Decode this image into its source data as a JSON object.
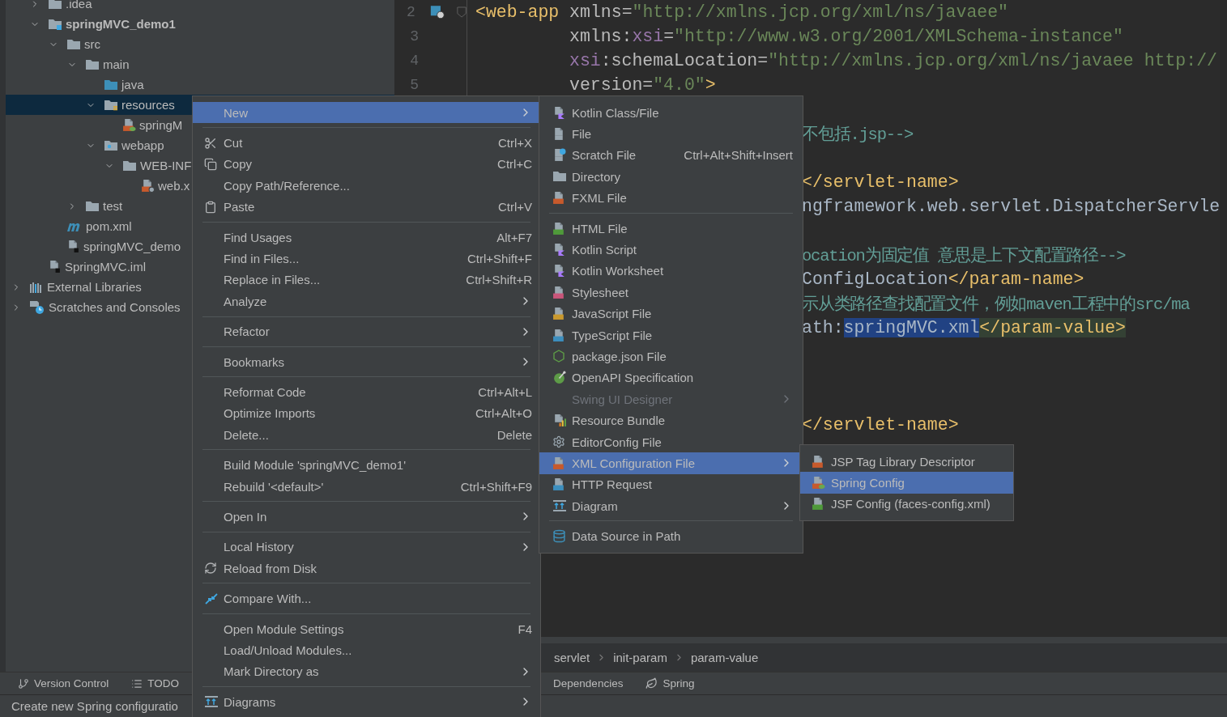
{
  "project_tree": [
    {
      "children": [
        {
          "label": ".idea",
          "kind": "folder",
          "expanded": false,
          "selected": false
        },
        {
          "label": "springMVC_demo1",
          "kind": "module",
          "expanded": true,
          "selected": false,
          "children": [
            {
              "label": "src",
              "kind": "folder",
              "expanded": true,
              "selected": false,
              "children": [
                {
                  "label": "main",
                  "kind": "folder",
                  "expanded": true,
                  "selected": false,
                  "children": [
                    {
                      "label": "java",
                      "kind": "source",
                      "selected": false
                    },
                    {
                      "label": "resources",
                      "kind": "resources",
                      "expanded": true,
                      "selected": true,
                      "children": [
                        {
                          "label": "springM",
                          "kind": "spring-xml",
                          "selected": false
                        }
                      ]
                    },
                    {
                      "label": "webapp",
                      "kind": "web",
                      "expanded": true,
                      "selected": false,
                      "children": [
                        {
                          "label": "WEB-INF",
                          "kind": "folder",
                          "expanded": true,
                          "selected": false,
                          "children": [
                            {
                              "label": "web.x",
                              "kind": "web-xml",
                              "selected": false
                            }
                          ]
                        }
                      ]
                    }
                  ]
                },
                {
                  "label": "test",
                  "kind": "folder",
                  "expanded": false,
                  "selected": false
                }
              ]
            },
            {
              "label": "pom.xml",
              "kind": "maven",
              "selected": false
            },
            {
              "label": "springMVC_demo",
              "kind": "iml",
              "selected": false
            }
          ]
        },
        {
          "label": "SpringMVC.iml",
          "kind": "iml",
          "selected": false
        }
      ]
    },
    {
      "label": "External Libraries",
      "kind": "libraries",
      "expanded": false,
      "selected": false
    },
    {
      "label": "Scratches and Consoles",
      "kind": "scratches",
      "expanded": false,
      "selected": false
    }
  ],
  "editor": {
    "lines": [
      {
        "kind": "first",
        "number": "2",
        "tokens": [
          {
            "t": "<web-app",
            "kind": "tag"
          },
          {
            "t": " xmlns=",
            "kind": "attr"
          },
          {
            "t": "\"http://xmlns.jcp.org/xml/ns/javaee\"",
            "kind": "val"
          }
        ]
      },
      {
        "kind": "cont",
        "number": "3",
        "tokens": [
          {
            "t": "xmlns:",
            "kind": "attr"
          },
          {
            "t": "xsi",
            "kind": "ns"
          },
          {
            "t": "=",
            "kind": "attr"
          },
          {
            "t": "\"http://www.w3.org/2001/XMLSchema-instance\"",
            "kind": "val"
          }
        ]
      },
      {
        "kind": "cont",
        "number": "4",
        "tokens": [
          {
            "t": "xsi",
            "kind": "ns"
          },
          {
            "t": ":schemaLocation=",
            "kind": "attr"
          },
          {
            "t": "\"http://xmlns.jcp.org/xml/ns/javaee http://",
            "kind": "val"
          }
        ]
      },
      {
        "kind": "cont",
        "number": "5",
        "tokens": [
          {
            "t": "version=",
            "kind": "attr"
          },
          {
            "t": "\"4.0\"",
            "kind": "val"
          },
          {
            "t": ">",
            "kind": "tag"
          }
        ]
      },
      {
        "kind": "blank"
      },
      {
        "kind": "tail",
        "tokens": [
          {
            "t": "不包括.jsp-->",
            "kind": "comment"
          }
        ]
      },
      {
        "kind": "blank"
      },
      {
        "kind": "tail",
        "tokens": [
          {
            "t": "</servlet-name>",
            "kind": "tag"
          }
        ]
      },
      {
        "kind": "tail",
        "tokens": [
          {
            "t": "ngframework.web.servlet.DispatcherServle",
            "kind": "plain"
          }
        ]
      },
      {
        "kind": "blank"
      },
      {
        "kind": "tail",
        "tokens": [
          {
            "t": "ocation为固定值 意思是上下文配置路径-->",
            "kind": "comment"
          }
        ]
      },
      {
        "kind": "tail",
        "tokens": [
          {
            "t": "ConfigLocation",
            "kind": "plain"
          },
          {
            "t": "</param-name>",
            "kind": "tag"
          }
        ]
      },
      {
        "kind": "tail",
        "tokens": [
          {
            "t": "示从类路径查找配置文件，例如maven工程中的src/ma",
            "kind": "comment"
          }
        ]
      },
      {
        "kind": "tail",
        "tokens": [
          {
            "t": "ath:",
            "kind": "plain"
          },
          {
            "t": "springMVC.xml",
            "kind": "sel"
          },
          {
            "t": "</param-value>",
            "kind": "match"
          }
        ]
      },
      {
        "kind": "blank"
      },
      {
        "kind": "blank"
      },
      {
        "kind": "blank"
      },
      {
        "kind": "tail",
        "tokens": [
          {
            "t": "</servlet-name>",
            "kind": "tag"
          }
        ]
      }
    ]
  },
  "breadcrumbs": [
    "servlet",
    "init-param",
    "param-value"
  ],
  "tool_windows_left": [
    "Version Control",
    "TODO"
  ],
  "tool_windows_right": [
    "Dependencies",
    "Spring"
  ],
  "status_bar": "Create new Spring configuratio",
  "context_menu": {
    "items": [
      {
        "kind": "item",
        "label": "New",
        "submenu": true,
        "selected": true
      },
      {
        "kind": "separator"
      },
      {
        "kind": "item",
        "label": "Cut",
        "shortcut": "Ctrl+X",
        "submenu": false,
        "selected": false
      },
      {
        "kind": "item",
        "label": "Copy",
        "shortcut": "Ctrl+C",
        "submenu": false,
        "selected": false
      },
      {
        "kind": "item",
        "label": "Copy Path/Reference...",
        "submenu": false,
        "selected": false
      },
      {
        "kind": "item",
        "label": "Paste",
        "shortcut": "Ctrl+V",
        "submenu": false,
        "selected": false
      },
      {
        "kind": "separator"
      },
      {
        "kind": "item",
        "label": "Find Usages",
        "shortcut": "Alt+F7",
        "submenu": false,
        "selected": false
      },
      {
        "kind": "item",
        "label": "Find in Files...",
        "shortcut": "Ctrl+Shift+F",
        "submenu": false,
        "selected": false
      },
      {
        "kind": "item",
        "label": "Replace in Files...",
        "shortcut": "Ctrl+Shift+R",
        "submenu": false,
        "selected": false
      },
      {
        "kind": "item",
        "label": "Analyze",
        "submenu": true,
        "selected": false
      },
      {
        "kind": "separator"
      },
      {
        "kind": "item",
        "label": "Refactor",
        "submenu": true,
        "selected": false
      },
      {
        "kind": "separator"
      },
      {
        "kind": "item",
        "label": "Bookmarks",
        "submenu": true,
        "selected": false
      },
      {
        "kind": "separator"
      },
      {
        "kind": "item",
        "label": "Reformat Code",
        "shortcut": "Ctrl+Alt+L",
        "submenu": false,
        "selected": false
      },
      {
        "kind": "item",
        "label": "Optimize Imports",
        "shortcut": "Ctrl+Alt+O",
        "submenu": false,
        "selected": false
      },
      {
        "kind": "item",
        "label": "Delete...",
        "shortcut": "Delete",
        "submenu": false,
        "selected": false
      },
      {
        "kind": "separator"
      },
      {
        "kind": "item",
        "label": "Build Module 'springMVC_demo1'",
        "submenu": false,
        "selected": false
      },
      {
        "kind": "item",
        "label": "Rebuild '<default>'",
        "shortcut": "Ctrl+Shift+F9",
        "submenu": false,
        "selected": false
      },
      {
        "kind": "separator"
      },
      {
        "kind": "item",
        "label": "Open In",
        "submenu": true,
        "selected": false
      },
      {
        "kind": "separator"
      },
      {
        "kind": "item",
        "label": "Local History",
        "submenu": true,
        "selected": false
      },
      {
        "kind": "item",
        "label": "Reload from Disk",
        "submenu": false,
        "selected": false
      },
      {
        "kind": "separator"
      },
      {
        "kind": "item",
        "label": "Compare With...",
        "submenu": false,
        "selected": false
      },
      {
        "kind": "separator"
      },
      {
        "kind": "item",
        "label": "Open Module Settings",
        "shortcut": "F4",
        "submenu": false,
        "selected": false
      },
      {
        "kind": "item",
        "label": "Load/Unload Modules...",
        "submenu": false,
        "selected": false
      },
      {
        "kind": "item",
        "label": "Mark Directory as",
        "submenu": true,
        "selected": false
      },
      {
        "kind": "separator"
      },
      {
        "kind": "item",
        "label": "Diagrams",
        "submenu": true,
        "selected": false
      }
    ]
  },
  "new_submenu": {
    "items": [
      {
        "kind": "item",
        "label": "Kotlin Class/File",
        "submenu": false,
        "disabled": false,
        "selected": false
      },
      {
        "kind": "item",
        "label": "File",
        "submenu": false,
        "disabled": false,
        "selected": false
      },
      {
        "kind": "item",
        "label": "Scratch File",
        "shortcut": "Ctrl+Alt+Shift+Insert",
        "submenu": false,
        "disabled": false,
        "selected": false
      },
      {
        "kind": "item",
        "label": "Directory",
        "submenu": false,
        "disabled": false,
        "selected": false
      },
      {
        "kind": "item",
        "label": "FXML File",
        "submenu": false,
        "disabled": false,
        "selected": false
      },
      {
        "kind": "separator"
      },
      {
        "kind": "item",
        "label": "HTML File",
        "submenu": false,
        "disabled": false,
        "selected": false
      },
      {
        "kind": "item",
        "label": "Kotlin Script",
        "submenu": false,
        "disabled": false,
        "selected": false
      },
      {
        "kind": "item",
        "label": "Kotlin Worksheet",
        "submenu": false,
        "disabled": false,
        "selected": false
      },
      {
        "kind": "item",
        "label": "Stylesheet",
        "submenu": false,
        "disabled": false,
        "selected": false
      },
      {
        "kind": "item",
        "label": "JavaScript File",
        "submenu": false,
        "disabled": false,
        "selected": false
      },
      {
        "kind": "item",
        "label": "TypeScript File",
        "submenu": false,
        "disabled": false,
        "selected": false
      },
      {
        "kind": "item",
        "label": "package.json File",
        "submenu": false,
        "disabled": false,
        "selected": false
      },
      {
        "kind": "item",
        "label": "OpenAPI Specification",
        "submenu": false,
        "disabled": false,
        "selected": false
      },
      {
        "kind": "item",
        "label": "Swing UI Designer",
        "submenu": true,
        "disabled": true,
        "selected": false
      },
      {
        "kind": "item",
        "label": "Resource Bundle",
        "submenu": false,
        "disabled": false,
        "selected": false
      },
      {
        "kind": "item",
        "label": "EditorConfig File",
        "submenu": false,
        "disabled": false,
        "selected": false
      },
      {
        "kind": "item",
        "label": "XML Configuration File",
        "submenu": true,
        "disabled": false,
        "selected": true
      },
      {
        "kind": "item",
        "label": "HTTP Request",
        "submenu": false,
        "disabled": false,
        "selected": false
      },
      {
        "kind": "item",
        "label": "Diagram",
        "submenu": true,
        "disabled": false,
        "selected": false
      },
      {
        "kind": "separator"
      },
      {
        "kind": "item",
        "label": "Data Source in Path",
        "submenu": false,
        "disabled": false,
        "selected": false
      }
    ]
  },
  "xml_config_submenu": {
    "items": [
      {
        "kind": "item",
        "label": "JSP Tag Library Descriptor",
        "submenu": false,
        "selected": false
      },
      {
        "kind": "item",
        "label": "Spring Config",
        "submenu": false,
        "selected": true
      },
      {
        "kind": "item",
        "label": "JSF Config (faces-config.xml)",
        "submenu": false,
        "selected": false
      }
    ]
  }
}
